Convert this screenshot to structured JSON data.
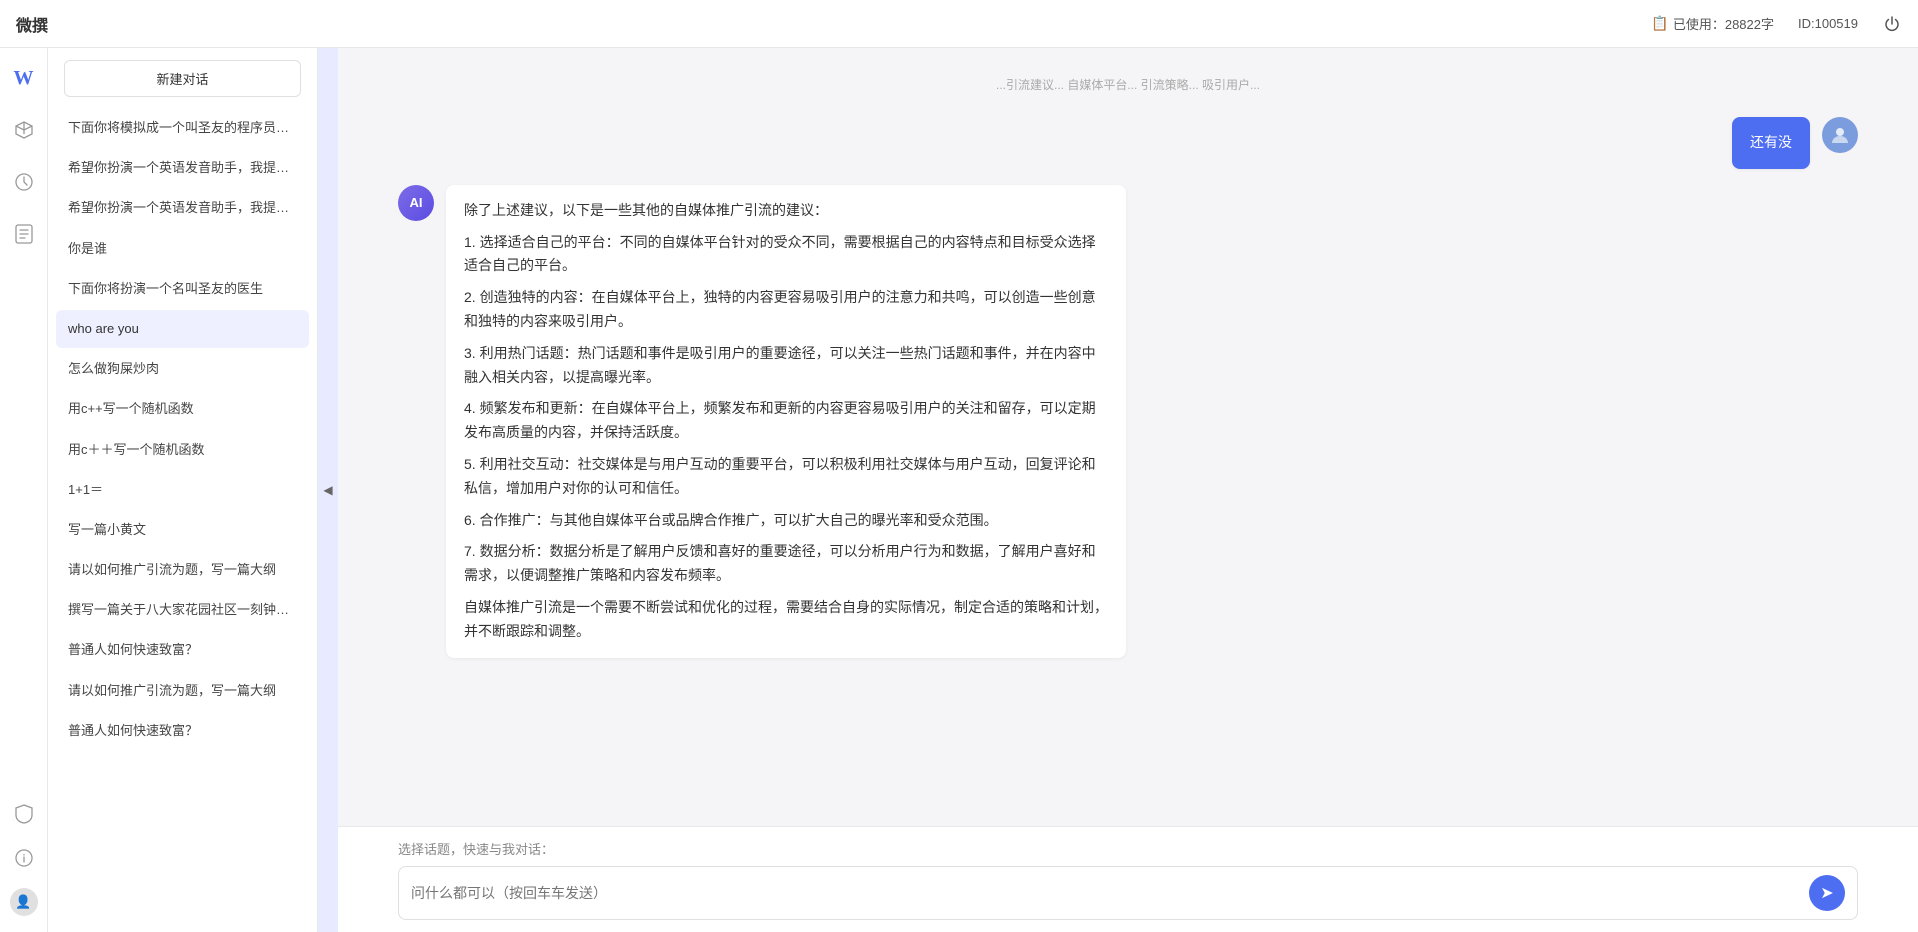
{
  "app": {
    "title": "微撰",
    "usage_label": "已使用：28822字",
    "id_label": "ID:100519"
  },
  "icon_sidebar": {
    "icons": [
      {
        "name": "home-icon",
        "symbol": "⊞",
        "active": false
      },
      {
        "name": "cube-icon",
        "symbol": "◈",
        "active": false
      },
      {
        "name": "clock-icon",
        "symbol": "⏱",
        "active": false
      },
      {
        "name": "document-icon",
        "symbol": "📄",
        "active": false
      }
    ],
    "bottom_icons": [
      {
        "name": "shield-icon",
        "symbol": "🛡"
      },
      {
        "name": "info-icon",
        "symbol": "ℹ"
      },
      {
        "name": "user-icon",
        "symbol": "👤"
      }
    ]
  },
  "conv_sidebar": {
    "new_btn_label": "新建对话",
    "items": [
      {
        "id": 1,
        "text": "下面你将模拟成一个叫圣友的程序员，我说...",
        "active": false
      },
      {
        "id": 2,
        "text": "希望你扮演一个英语发音助手，我提供给你...",
        "active": false
      },
      {
        "id": 3,
        "text": "希望你扮演一个英语发音助手，我提供给你...",
        "active": false
      },
      {
        "id": 4,
        "text": "你是谁",
        "active": false
      },
      {
        "id": 5,
        "text": "下面你将扮演一个名叫圣友的医生",
        "active": false
      },
      {
        "id": 6,
        "text": "who are you",
        "active": true
      },
      {
        "id": 7,
        "text": "怎么做狗屎炒肉",
        "active": false
      },
      {
        "id": 8,
        "text": "用c++写一个随机函数",
        "active": false
      },
      {
        "id": 9,
        "text": "用c＋＋写一个随机函数",
        "active": false
      },
      {
        "id": 10,
        "text": "1+1＝",
        "active": false
      },
      {
        "id": 11,
        "text": "写一篇小黄文",
        "active": false
      },
      {
        "id": 12,
        "text": "请以如何推广引流为题，写一篇大纲",
        "active": false
      },
      {
        "id": 13,
        "text": "撰写一篇关于八大家花园社区一刻钟便民生...",
        "active": false
      },
      {
        "id": 14,
        "text": "普通人如何快速致富？",
        "active": false
      },
      {
        "id": 15,
        "text": "请以如何推广引流为题，写一篇大纲",
        "active": false
      },
      {
        "id": 16,
        "text": "普通人如何快速致富？",
        "active": false
      }
    ]
  },
  "chat": {
    "truncated_msg": "...XXXXXX 引流建议 XXXXXX 自媒体平台 XXXXXX 引流策略 XXXXXX 吸引用户...",
    "messages": [
      {
        "role": "user",
        "text": "还有没",
        "avatar_type": "user"
      },
      {
        "role": "ai",
        "avatar_type": "ai",
        "text": "除了上述建议，以下是一些其他的自媒体推广引流的建议：\n\n1. 选择适合自己的平台：不同的自媒体平台针对的受众不同，需要根据自己的内容特点和目标受众选择适合自己的平台。\n\n2. 创造独特的内容：在自媒体平台上，独特的内容更容易吸引用户的注意力和共鸣，可以创造一些创意和独特的内容来吸引用户。\n\n3. 利用热门话题：热门话题和事件是吸引用户的重要途径，可以关注一些热门话题和事件，并在内容中融入相关内容，以提高曝光率。\n\n4. 频繁发布和更新：在自媒体平台上，频繁发布和更新的内容更容易吸引用户的关注和留存，可以定期发布高质量的内容，并保持活跃度。\n\n5. 利用社交互动：社交媒体是与用户互动的重要平台，可以积极利用社交媒体与用户互动，回复评论和私信，增加用户对你的认可和信任。\n\n6. 合作推广：与其他自媒体平台或品牌合作推广，可以扩大自己的曝光率和受众范围。\n\n7. 数据分析：数据分析是了解用户反馈和喜好的重要途径，可以分析用户行为和数据，了解用户喜好和需求，以便调整推广策略和内容发布频率。\n\n自媒体推广引流是一个需要不断尝试和优化的过程，需要结合自身的实际情况，制定合适的策略和计划，并不断跟踪和调整。"
      }
    ],
    "input_placeholder": "问什么都可以（按回车车发送）",
    "quick_prompts_label": "选择话题，快速与我对话：",
    "send_btn_label": "发送"
  }
}
